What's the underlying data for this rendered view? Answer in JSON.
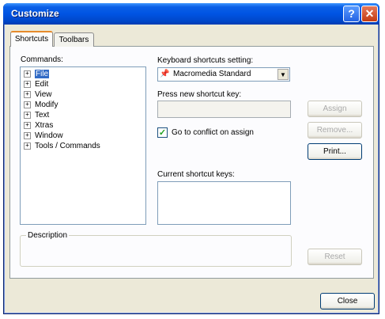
{
  "window": {
    "title": "Customize",
    "help": "?",
    "close": "✕"
  },
  "tabs": [
    "Shortcuts",
    "Toolbars"
  ],
  "commands": {
    "label": "Commands:",
    "items": [
      "File",
      "Edit",
      "View",
      "Modify",
      "Text",
      "Xtras",
      "Window",
      "Tools / Commands"
    ],
    "selected": "File"
  },
  "keyboard": {
    "label": "Keyboard shortcuts setting:",
    "selected": "Macromedia Standard",
    "icon": "pin-icon"
  },
  "new_key": {
    "label": "Press new shortcut key:",
    "value": ""
  },
  "conflict": {
    "label": "Go to conflict on assign",
    "checked": true
  },
  "current_keys": {
    "label": "Current shortcut keys:"
  },
  "description": {
    "label": "Description"
  },
  "buttons": {
    "assign": "Assign",
    "remove": "Remove...",
    "print": "Print...",
    "reset": "Reset",
    "close": "Close"
  },
  "colors": {
    "titlebar": "#0054e3",
    "selection": "#316ac5",
    "face": "#ece9d8"
  }
}
